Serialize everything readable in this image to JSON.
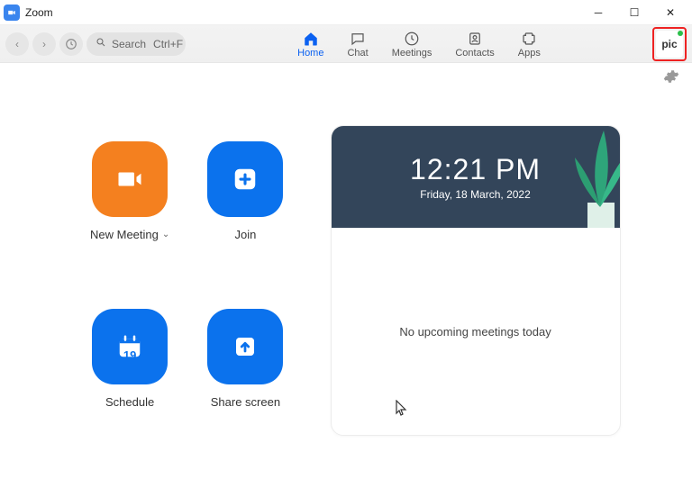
{
  "titlebar": {
    "app_name": "Zoom"
  },
  "toolbar": {
    "search_label": "Search",
    "search_shortcut": "Ctrl+F"
  },
  "nav": {
    "home": "Home",
    "chat": "Chat",
    "meetings": "Meetings",
    "contacts": "Contacts",
    "apps": "Apps"
  },
  "avatar": {
    "text": "pic"
  },
  "tiles": {
    "new_meeting": "New Meeting",
    "join": "Join",
    "schedule": "Schedule",
    "schedule_day": "19",
    "share": "Share screen"
  },
  "calendar": {
    "time": "12:21 PM",
    "date": "Friday, 18 March, 2022",
    "empty_msg": "No upcoming meetings today"
  }
}
